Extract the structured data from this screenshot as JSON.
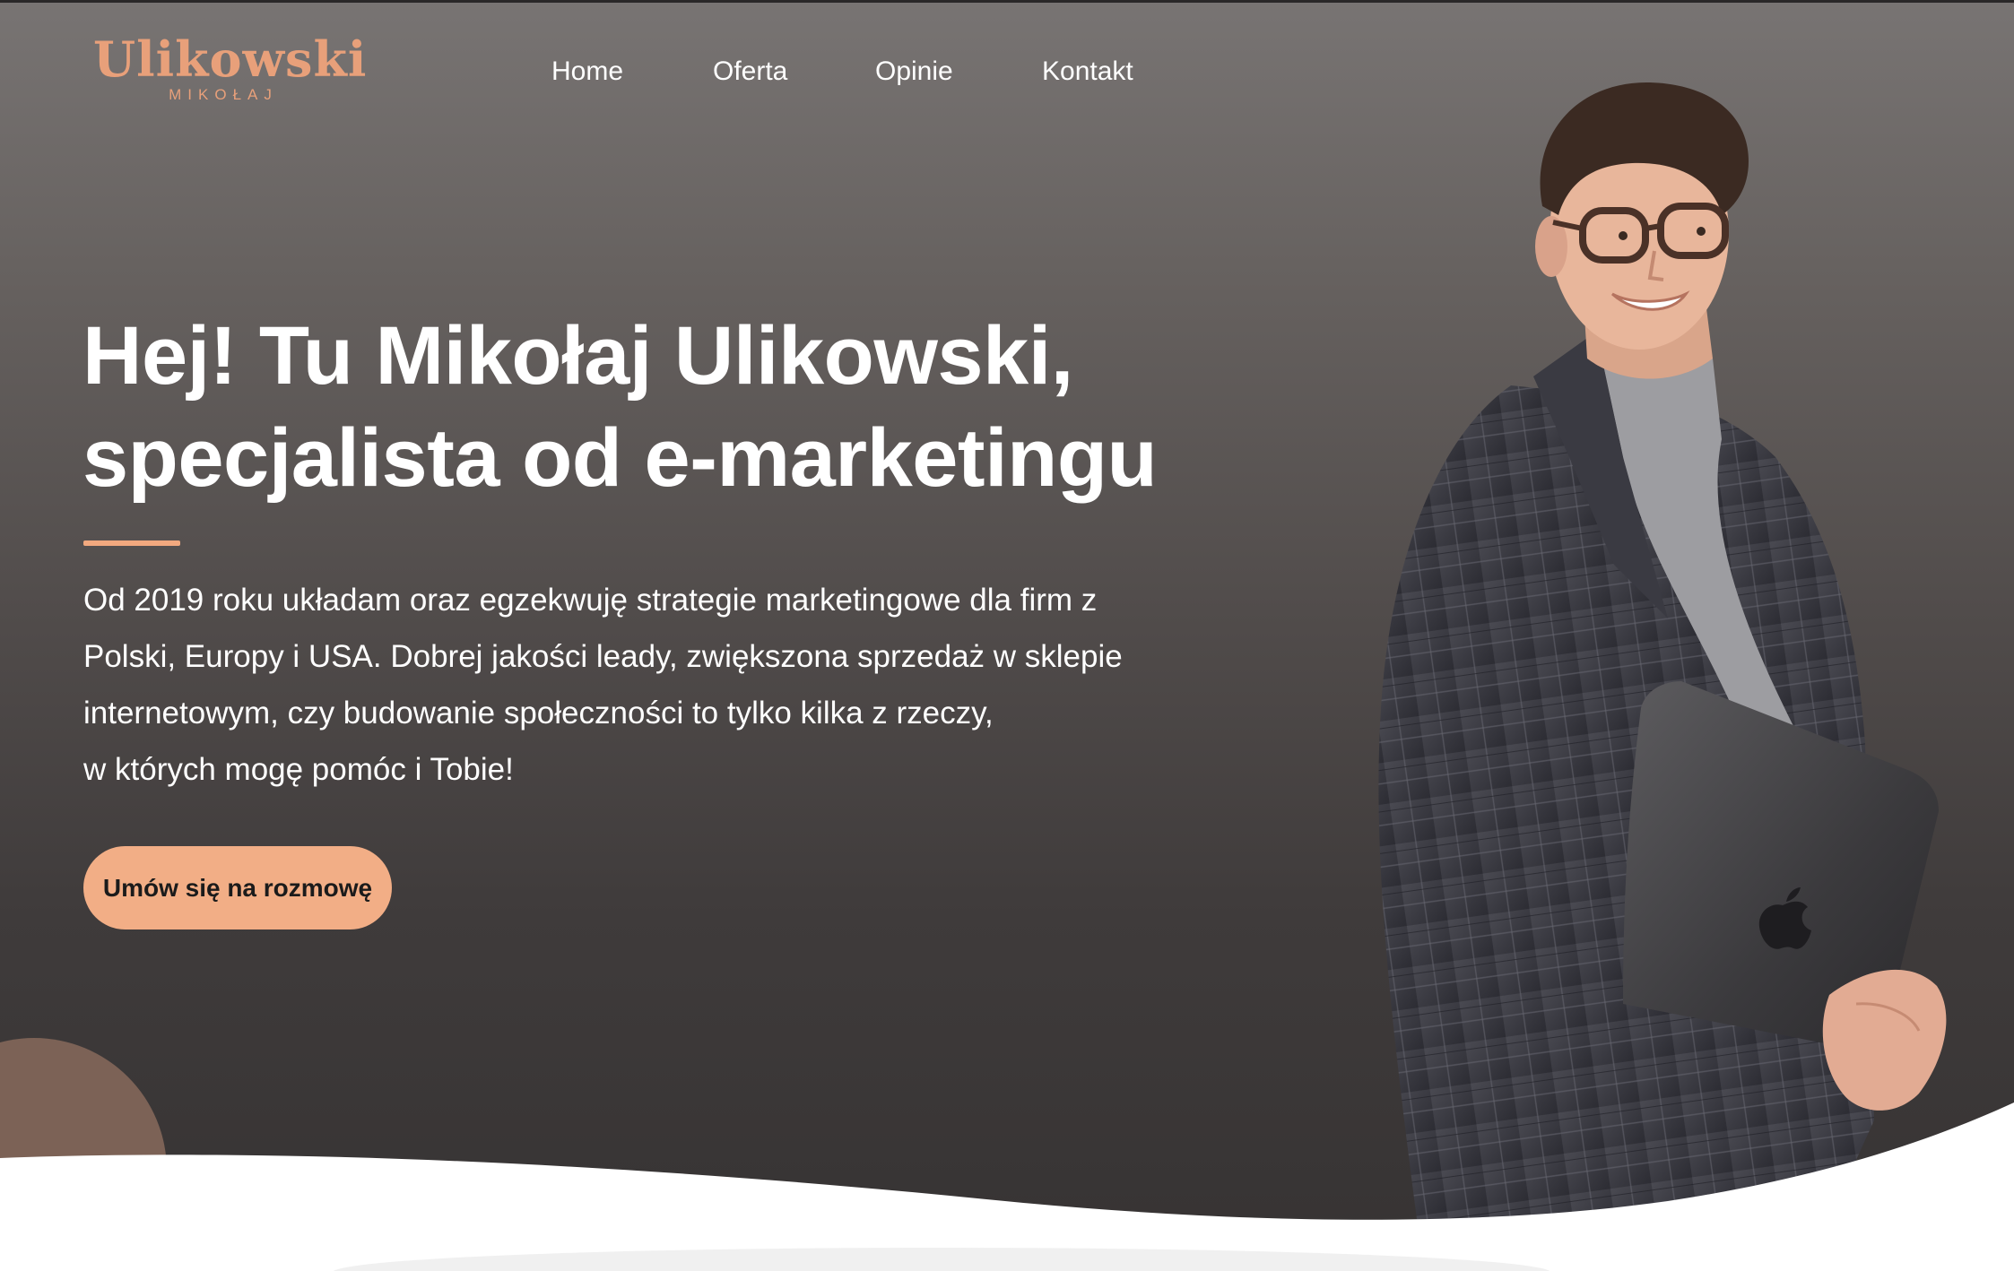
{
  "brand": {
    "name": "Ulikowski",
    "sub": "MIKOŁAJ",
    "accent_color": "#f2ae86"
  },
  "nav": {
    "items": [
      {
        "label": "Home"
      },
      {
        "label": "Oferta"
      },
      {
        "label": "Opinie"
      },
      {
        "label": "Kontakt"
      }
    ]
  },
  "hero": {
    "headline_line1": "Hej! Tu Mikołaj Ulikowski,",
    "headline_line2": "specjalista od e-marketingu",
    "intro_lines": [
      "Od 2019 roku układam oraz egzekwuję strategie marketingowe dla firm z",
      "Polski, Europy i USA. Dobrej jakości leady, zwiększona sprzedaż w sklepie",
      "internetowym, czy budowanie społeczności to tylko kilka z rzeczy,",
      "w których mogę pomóc i Tobie!"
    ],
    "cta_label": "Umów się na rozmowę"
  },
  "icons": [
    "apple-logo-icon"
  ],
  "colors": {
    "background_top": "#787473",
    "background_bottom": "#363333",
    "accent": "#f2ae86",
    "logo": "#e8a07a",
    "decor_circle": "#7c6256"
  }
}
